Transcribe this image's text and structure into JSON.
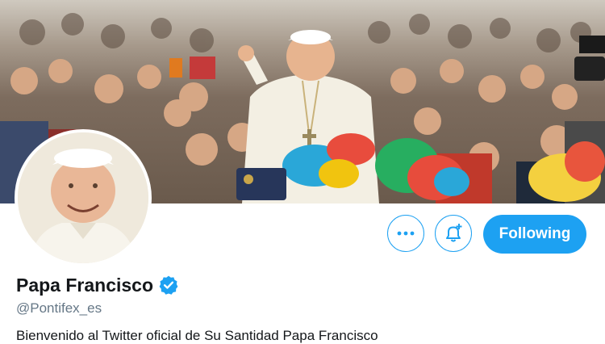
{
  "profile": {
    "display_name": "Papa Francisco",
    "handle": "@Pontifex_es",
    "bio": "Bienvenido al Twitter oficial de Su Santidad Papa Francisco"
  },
  "actions": {
    "more_icon": "more-dots-icon",
    "notify_icon": "bell-plus-icon",
    "follow_label": "Following"
  },
  "colors": {
    "accent": "#1da1f2",
    "verified": "#1da1f2",
    "name": "#14171a",
    "handle": "#657786"
  },
  "icons": {
    "verified": "verified-badge-icon"
  }
}
